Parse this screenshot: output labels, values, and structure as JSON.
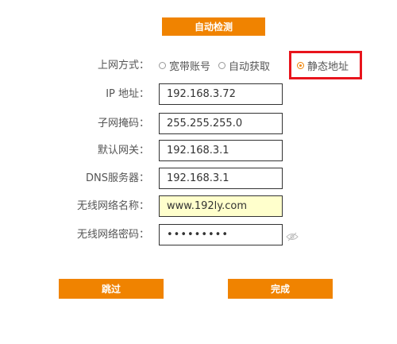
{
  "buttons": {
    "auto_detect": "自动检测",
    "skip": "跳过",
    "finish": "完成"
  },
  "connection_type": {
    "label": "上网方式：",
    "options": [
      {
        "label": "宽带账号",
        "selected": false
      },
      {
        "label": "自动获取",
        "selected": false
      },
      {
        "label": "静态地址",
        "selected": true
      }
    ]
  },
  "fields": {
    "ip": {
      "label": "IP 地址：",
      "value": "192.168.3.72"
    },
    "subnet": {
      "label": "子网掩码：",
      "value": "255.255.255.0"
    },
    "gateway": {
      "label": "默认网关：",
      "value": "192.168.3.1"
    },
    "dns": {
      "label": "DNS服务器：",
      "value": "192.168.3.1"
    },
    "wifi_name": {
      "label": "无线网络名称：",
      "value": "www.192ly.com"
    },
    "wifi_password": {
      "label": "无线网络密码：",
      "value": "•••••••••"
    }
  },
  "icons": {
    "password_toggle": "eye-slash-icon"
  },
  "colors": {
    "accent": "#f08300",
    "highlight_box": "#e8141c",
    "wifi_name_bg": "#ffffcc"
  }
}
